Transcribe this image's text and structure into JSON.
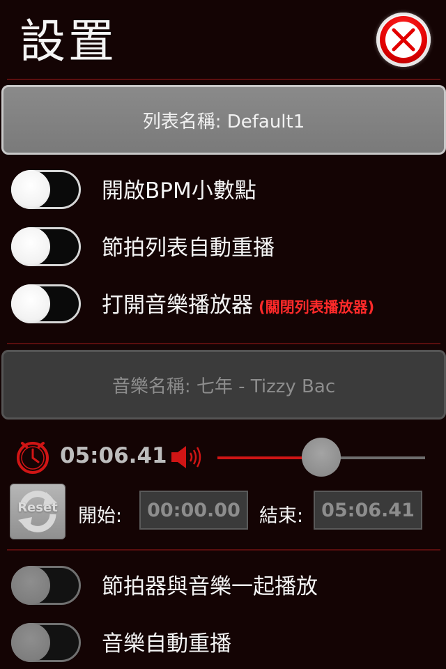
{
  "header": {
    "title": "設置"
  },
  "list_button": {
    "label": "列表名稱: Default1"
  },
  "toggles": [
    {
      "label": "開啟BPM小數點",
      "on": false
    },
    {
      "label": "節拍列表自動重播",
      "on": false
    },
    {
      "label": "打開音樂播放器",
      "sublabel": "(關閉列表播放器)",
      "on": false
    }
  ],
  "music_button": {
    "label": "音樂名稱: 七年 - Tizzy Bac"
  },
  "player": {
    "time": "05:06.41",
    "volume_level": 0.5
  },
  "range": {
    "reset_label": "Reset",
    "start_label": "開始:",
    "start_value": "00:00.00",
    "end_label": "結束:",
    "end_value": "05:06.41"
  },
  "music_toggles": [
    {
      "label": "節拍器與音樂一起播放",
      "on": false
    },
    {
      "label": "音樂自動重播",
      "on": false
    }
  ],
  "colors": {
    "accent": "#e20000",
    "background": "#140404"
  },
  "icons": {
    "close": "close-icon",
    "clock": "clock-icon",
    "speaker": "speaker-icon",
    "reset": "reset-icon"
  }
}
